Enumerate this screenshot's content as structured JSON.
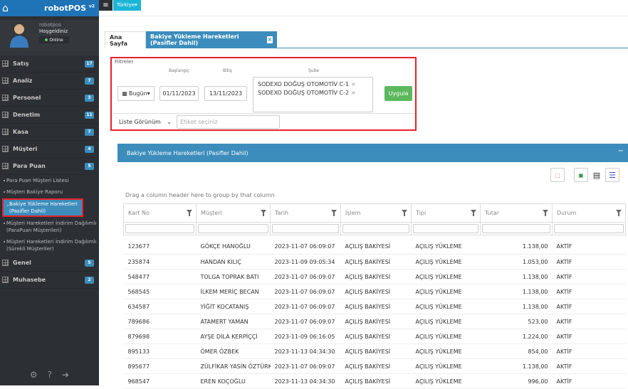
{
  "sidebar": {
    "brand": "robotPOS",
    "brand_version": "v2",
    "user": {
      "name": "robotpos",
      "welcome": "Hoşgeldiniz",
      "status": "Online"
    },
    "menu": [
      {
        "label": "Satış",
        "badge": "17"
      },
      {
        "label": "Analiz",
        "badge": "7"
      },
      {
        "label": "Personel",
        "badge": "3"
      },
      {
        "label": "Denetim",
        "badge": "11"
      },
      {
        "label": "Kasa",
        "badge": "7"
      },
      {
        "label": "Müşteri",
        "badge": "4"
      },
      {
        "label": "Para Puan",
        "badge": "5"
      }
    ],
    "submenu": [
      "Para Puan Müşteri Listesi",
      "Müşteri Bakiye Raporu",
      "Bakiye Yükleme Hareketleri (Pasifler Dahil)",
      "Müşteri Hareketleri İndirim Dağılımlı (ParaPuan Müşterileri)",
      "Müşteri Hareketleri İndirim Dağılımlı (Sürekli Müşteriler)"
    ],
    "menu_after": [
      {
        "label": "Genel",
        "badge": "5"
      },
      {
        "label": "Muhasebe",
        "badge": "2"
      }
    ]
  },
  "topbar": {
    "language": "Türkiye"
  },
  "tabs": {
    "home": "Ana Sayfa",
    "active": "Bakiye Yükleme Hareketleri (Pasifler Dahil)",
    "close": "×"
  },
  "filters": {
    "legend": "Filtreler",
    "start_label": "Başlangıç",
    "end_label": "Bitiş",
    "branch_label": "Şube",
    "period": "Bugün",
    "start": "01/11/2023",
    "end": "13/11/2023",
    "branches": [
      "SODEXO DOĞUŞ OTOMOTİV C-1",
      "SODEXO DOĞUŞ OTOMOTİV C-2"
    ],
    "apply": "Uygula",
    "view": "Liste Görünüm",
    "tag_placeholder": "Etiket seçiniz"
  },
  "panel": {
    "title": "Bakiye Yükleme Hareketleri (Pasifler Dahil)",
    "group_hint": "Drag a column header here to group by that column"
  },
  "colors": {
    "accent": "#3c8dbc",
    "highlight": "#e8212b",
    "sidebar": "#2c2f33",
    "apply": "#5cb85c"
  },
  "grid": {
    "columns": [
      "Kart No",
      "Müşteri",
      "Tarih",
      "İşlem",
      "Tipi",
      "Tutar",
      "Durum"
    ],
    "rows": [
      [
        "123677",
        "GÖKÇE HANOĞLU",
        "2023-11-07 06:09:07",
        "AÇILIŞ BAKİYESİ",
        "AÇILIŞ YÜKLEME",
        "1.138,00",
        "AKTİF"
      ],
      [
        "235874",
        "HANDAN KILIÇ",
        "2023-11-09 09:05:34",
        "AÇILIŞ BAKİYESİ",
        "AÇILIŞ YÜKLEME",
        "1.053,00",
        "AKTİF"
      ],
      [
        "548477",
        "TOLGA TOPRAK BATI",
        "2023-11-07 06:09:07",
        "AÇILIŞ BAKİYESİ",
        "AÇILIŞ YÜKLEME",
        "1.138,00",
        "AKTİF"
      ],
      [
        "568545",
        "İLKEM MERİÇ BECAN",
        "2023-11-07 06:09:07",
        "AÇILIŞ BAKİYESİ",
        "AÇILIŞ YÜKLEME",
        "1.138,00",
        "AKTİF"
      ],
      [
        "634587",
        "YİĞİT KOCATANIŞ",
        "2023-11-07 06:09:07",
        "AÇILIŞ BAKİYESİ",
        "AÇILIŞ YÜKLEME",
        "1.138,00",
        "AKTİF"
      ],
      [
        "789686",
        "ATAMERT YAMAN",
        "2023-11-07 06:09:07",
        "AÇILIŞ BAKİYESİ",
        "AÇILIŞ YÜKLEME",
        "523,00",
        "AKTİF"
      ],
      [
        "879698",
        "AYŞE DİLA KERPİÇÇİ",
        "2023-11-09 06:16:05",
        "AÇILIŞ BAKİYESİ",
        "AÇILIŞ YÜKLEME",
        "1.224,00",
        "AKTİF"
      ],
      [
        "895133",
        "ÖMER ÖZBEK",
        "2023-11-13 04:34:30",
        "AÇILIŞ BAKİYESİ",
        "AÇILIŞ YÜKLEME",
        "854,00",
        "AKTİF"
      ],
      [
        "895677",
        "ZÜLFİKAR YASİN ÖZTÜRK",
        "2023-11-07 06:09:07",
        "AÇILIŞ BAKİYESİ",
        "AÇILIŞ YÜKLEME",
        "1.138,00",
        "AKTİF"
      ],
      [
        "968547",
        "EREN KOÇOĞLU",
        "2023-11-13 04:34:30",
        "AÇILIŞ BAKİYESİ",
        "AÇILIŞ YÜKLEME",
        "996,00",
        "AKTİF"
      ]
    ]
  }
}
